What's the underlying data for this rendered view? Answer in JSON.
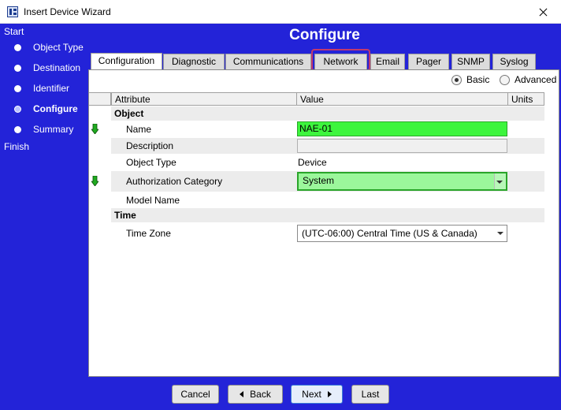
{
  "window": {
    "title": "Insert Device Wizard"
  },
  "steps": {
    "start": "Start",
    "items": [
      {
        "label": "Object Type"
      },
      {
        "label": "Destination"
      },
      {
        "label": "Identifier"
      },
      {
        "label": "Configure",
        "active": true
      },
      {
        "label": "Summary"
      }
    ],
    "finish": "Finish"
  },
  "panel": {
    "title": "Configure"
  },
  "tabs": [
    "Configuration",
    "Diagnostic",
    "Communications",
    "Network",
    "Email",
    "Pager",
    "SNMP",
    "Syslog"
  ],
  "view_mode": {
    "basic": "Basic",
    "advanced": "Advanced",
    "selected": "Basic"
  },
  "grid": {
    "headers": {
      "attribute": "Attribute",
      "value": "Value",
      "units": "Units"
    },
    "groups": {
      "object": "Object",
      "time": "Time"
    },
    "rows": {
      "name": {
        "label": "Name",
        "value": "NAE-01"
      },
      "description": {
        "label": "Description",
        "value": ""
      },
      "object_type": {
        "label": "Object Type",
        "value": "Device"
      },
      "auth_category": {
        "label": "Authorization Category",
        "value": "System"
      },
      "model_name": {
        "label": "Model Name",
        "value": ""
      },
      "time_zone": {
        "label": "Time Zone",
        "value": "(UTC-06:00) Central Time (US & Canada)"
      }
    }
  },
  "buttons": {
    "cancel": "Cancel",
    "back": "Back",
    "next": "Next",
    "last": "Last"
  },
  "colors": {
    "frame": "#2323d8",
    "required_field": "#3df53d",
    "required_select": "#9bf79b",
    "highlight": "#c0396e"
  },
  "icons": {
    "required_marker": "down-arrow-icon"
  }
}
